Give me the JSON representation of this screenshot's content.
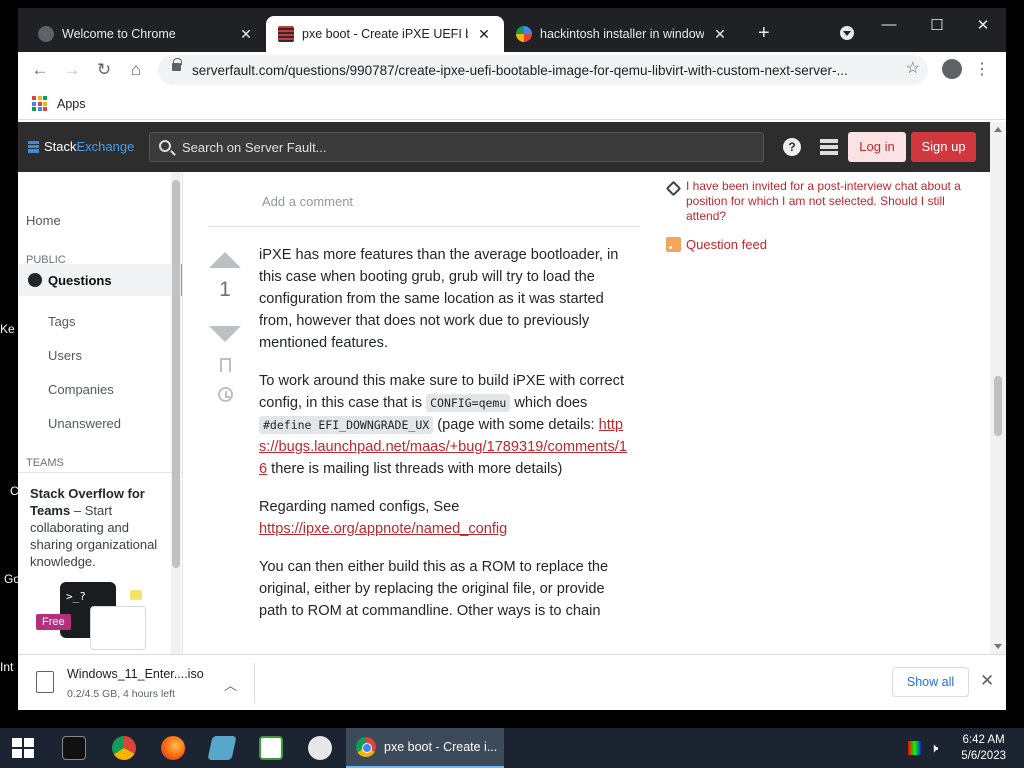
{
  "desktop": {
    "labels": [
      "Ke",
      "C",
      "Go",
      "Int"
    ]
  },
  "browser": {
    "tabs": [
      {
        "title": "Welcome to Chrome",
        "active": false
      },
      {
        "title": "pxe boot - Create iPXE UEFI boot",
        "active": true
      },
      {
        "title": "hackintosh installer in windows -",
        "active": false
      }
    ],
    "url": "serverfault.com/questions/990787/create-ipxe-uefi-bootable-image-for-qemu-libvirt-with-custom-next-server-...",
    "bookmarks": {
      "apps_label": "Apps"
    }
  },
  "se_header": {
    "logo_part1": "Stack",
    "logo_part2": "Exchange",
    "search_placeholder": "Search on Server Fault...",
    "login_label": "Log in",
    "signup_label": "Sign up"
  },
  "leftnav": {
    "home": "Home",
    "public_header": "PUBLIC",
    "questions": "Questions",
    "items": [
      "Tags",
      "Users",
      "Companies",
      "Unanswered"
    ],
    "teams_header": "TEAMS",
    "teams_title": "Stack Overflow for Teams",
    "teams_dash": " – Start collaborating and sharing organizational knowledge.",
    "free_badge": "Free",
    "terminal_text": ">_?"
  },
  "main": {
    "add_comment": "Add a comment",
    "vote_count": "1",
    "answer": {
      "p1": "iPXE has more features than the average bootloader, in this case when booting grub, grub will try to load the configuration from the same location as it was started from, however that does not work due to previously mentioned features.",
      "p2_a": "To work around this make sure to build iPXE with correct config, in this case that is ",
      "p2_code1": "CONFIG=qemu",
      "p2_b": " which does ",
      "p2_code2": "#define EFI_DOWNGRADE_UX",
      "p2_c": " (page with some details: ",
      "p2_link": "https://bugs.launchpad.net/maas/+bug/1789319/comments/16",
      "p2_d": " there is mailing list threads with more details)",
      "p3_a": "Regarding named configs, See ",
      "p3_link": "https://ipxe.org/appnote/named_config",
      "p4": "You can then either build this as a ROM to replace the original, either by replacing the original file, or provide path to ROM at commandline. Other ways is to chain"
    }
  },
  "sidebar": {
    "hot_question": "I have been invited for a post-interview chat about a position for which I am not selected. Should I still attend?",
    "feed_label": "Question feed"
  },
  "download": {
    "filename": "Windows_11_Enter....iso",
    "status": "0.2/4.5 GB, 4 hours left",
    "show_all": "Show all"
  },
  "taskbar": {
    "active_window": "pxe boot - Create i...",
    "time": "6:42 AM",
    "date": "5/6/2023"
  },
  "colors": {
    "link": "#c0272c",
    "se_accent": "#f48225",
    "signup_bg": "#d1383d"
  }
}
